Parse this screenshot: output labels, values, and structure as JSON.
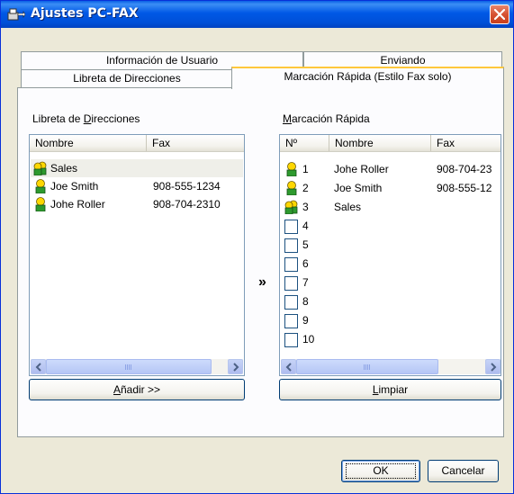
{
  "window": {
    "title": "Ajustes PC-FAX"
  },
  "tabs": {
    "row_back": [
      {
        "label": "Información de Usuario"
      },
      {
        "label": "Enviando"
      }
    ],
    "row_front": [
      {
        "label": "Libreta de Direcciones"
      },
      {
        "label": "Marcación Rápida (Estilo Fax solo)"
      }
    ]
  },
  "address_book": {
    "group_label_pre": "Libreta de ",
    "group_label_accel": "D",
    "group_label_post": "irecciones",
    "columns": [
      "Nombre",
      "Fax"
    ],
    "rows": [
      {
        "icon": "group-icon",
        "name": "Sales",
        "fax": ""
      },
      {
        "icon": "person-icon",
        "name": "Joe Smith",
        "fax": "908-555-1234"
      },
      {
        "icon": "person-icon",
        "name": "Johe Roller",
        "fax": "908-704-2310"
      }
    ],
    "add_button_accel": "A",
    "add_button_post": "ñadir >>"
  },
  "transfer_arrow": "»",
  "speed_dial": {
    "group_label_accel": "M",
    "group_label_post": "arcación Rápida",
    "columns": [
      "Nº",
      "Nombre",
      "Fax"
    ],
    "rows": [
      {
        "icon": "person-icon",
        "num": "1",
        "name": "Johe Roller",
        "fax": "908-704-23"
      },
      {
        "icon": "person-icon",
        "num": "2",
        "name": "Joe Smith",
        "fax": "908-555-12"
      },
      {
        "icon": "group-icon",
        "num": "3",
        "name": "Sales",
        "fax": ""
      },
      {
        "icon": "empty-slot",
        "num": "4",
        "name": "",
        "fax": ""
      },
      {
        "icon": "empty-slot",
        "num": "5",
        "name": "",
        "fax": ""
      },
      {
        "icon": "empty-slot",
        "num": "6",
        "name": "",
        "fax": ""
      },
      {
        "icon": "empty-slot",
        "num": "7",
        "name": "",
        "fax": ""
      },
      {
        "icon": "empty-slot",
        "num": "8",
        "name": "",
        "fax": ""
      },
      {
        "icon": "empty-slot",
        "num": "9",
        "name": "",
        "fax": ""
      },
      {
        "icon": "empty-slot",
        "num": "10",
        "name": "",
        "fax": ""
      }
    ],
    "clear_button_accel": "L",
    "clear_button_post": "impiar"
  },
  "footer": {
    "ok_label": "OK",
    "cancel_label": "Cancelar"
  },
  "colors": {
    "titlebar": "#0058e6",
    "dialog_bg": "#ece9d8",
    "panel_bg": "#fcfcfe",
    "close_red": "#d65233"
  }
}
